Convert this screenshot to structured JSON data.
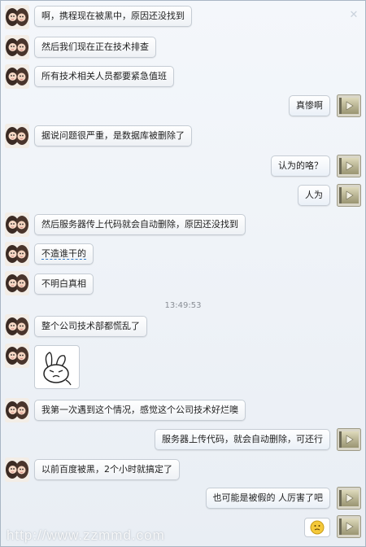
{
  "close_icon": "close-icon",
  "messages": [
    {
      "side": "left",
      "text": "啊，携程现在被黑中，原因还没找到"
    },
    {
      "side": "left",
      "text": "然后我们现在正在技术排查"
    },
    {
      "side": "left",
      "text": "所有技术相关人员都要紧急值班"
    },
    {
      "side": "right",
      "text": "真惨啊"
    },
    {
      "side": "left",
      "text": "据说问题很严重，是数据库被删除了"
    },
    {
      "side": "right",
      "text": "认为的咯？"
    },
    {
      "side": "right",
      "text": "人为"
    },
    {
      "side": "left",
      "text": "然后服务器传上代码就会自动删除，原因还没找到"
    },
    {
      "side": "left",
      "text": "不造谁干的"
    },
    {
      "side": "left",
      "text": "不明白真相"
    },
    {
      "side": "left",
      "text": "整个公司技术部都慌乱了"
    },
    {
      "side": "left",
      "text": "我第一次遇到这个情况，感觉这个公司技术好烂噢"
    },
    {
      "side": "right",
      "text": "服务器上传代码，就会自动删除，可还行"
    },
    {
      "side": "left",
      "text": "以前百度被黑，2个小时就搞定了"
    },
    {
      "side": "right",
      "text": "也可能是被假的 人厉害了吧"
    }
  ],
  "timestamp": "13:49:53",
  "watermark": "http://www.zzmmd.com"
}
